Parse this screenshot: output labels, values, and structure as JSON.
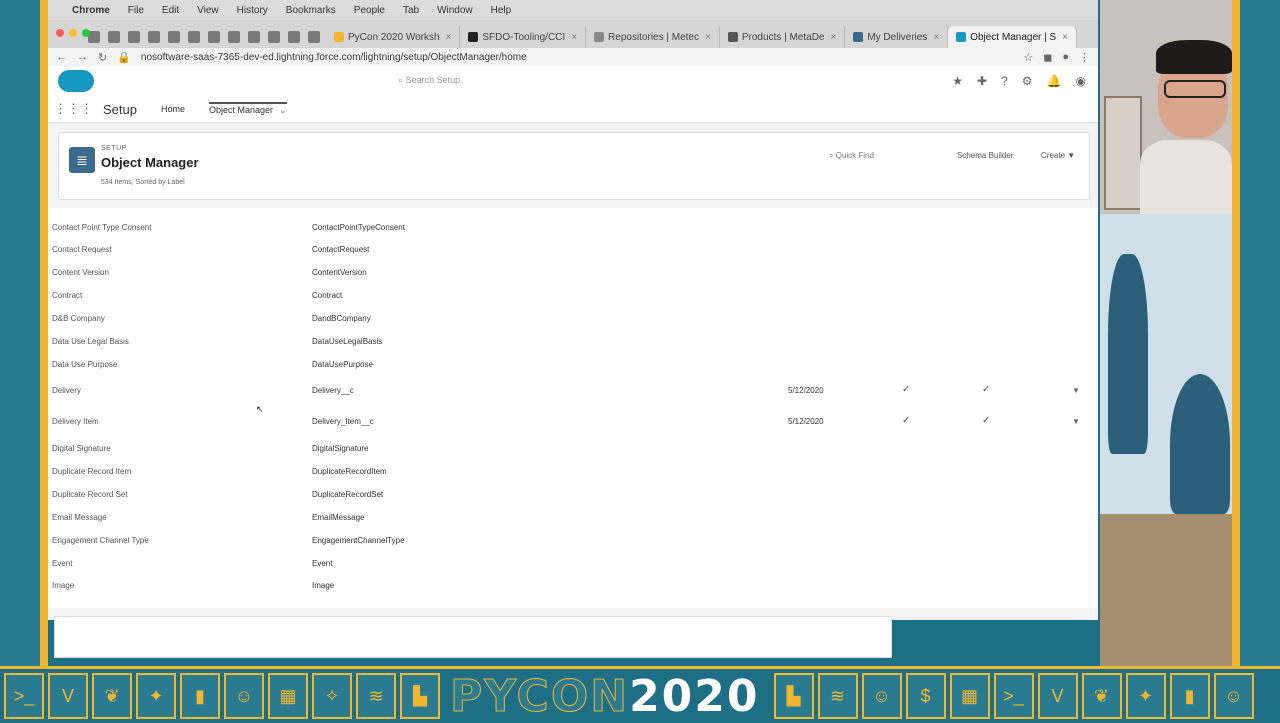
{
  "browser": {
    "menubar": [
      "Chrome",
      "File",
      "Edit",
      "View",
      "History",
      "Bookmarks",
      "People",
      "Tab",
      "Window",
      "Help"
    ],
    "tabs": [
      {
        "label": "PyCon 2020 Worksh",
        "color": "#f2b631",
        "active": false
      },
      {
        "label": "SFDO-Tooling/CCI",
        "color": "#222222",
        "active": false
      },
      {
        "label": "Repositories | Metec",
        "color": "#888888",
        "active": false
      },
      {
        "label": "Products | MetaDe",
        "color": "#555555",
        "active": false
      },
      {
        "label": "My Deliveries",
        "color": "#3b6b8c",
        "active": false
      },
      {
        "label": "Object Manager | S",
        "color": "#1798c1",
        "active": true
      }
    ],
    "url": "nosoftware-saas-7365-dev-ed.lightning.force.com/lightning/setup/ObjectManager/home"
  },
  "salesforce": {
    "search_placeholder": "Search Setup",
    "app_name": "Setup",
    "nav": {
      "home": "Home",
      "object_manager": "Object Manager"
    }
  },
  "header": {
    "breadcrumb": "SETUP",
    "title": "Object Manager",
    "item_count": "534 Items, Sorted by Label",
    "quick_find": "Quick Find",
    "schema_builder": "Schema Builder",
    "create": "Create"
  },
  "objects": [
    {
      "label": "Contact Point Type Consent",
      "api": "ContactPointTypeConsent",
      "date": "",
      "c1": "",
      "c2": "",
      "menu": ""
    },
    {
      "label": "Contact Request",
      "api": "ContactRequest",
      "date": "",
      "c1": "",
      "c2": "",
      "menu": ""
    },
    {
      "label": "Content Version",
      "api": "ContentVersion",
      "date": "",
      "c1": "",
      "c2": "",
      "menu": ""
    },
    {
      "label": "Contract",
      "api": "Contract",
      "date": "",
      "c1": "",
      "c2": "",
      "menu": ""
    },
    {
      "label": "D&B Company",
      "api": "DandBCompany",
      "date": "",
      "c1": "",
      "c2": "",
      "menu": ""
    },
    {
      "label": "Data Use Legal Basis",
      "api": "DataUseLegalBasis",
      "date": "",
      "c1": "",
      "c2": "",
      "menu": ""
    },
    {
      "label": "Data Use Purpose",
      "api": "DataUsePurpose",
      "date": "",
      "c1": "",
      "c2": "",
      "menu": ""
    },
    {
      "label": "Delivery",
      "api": "Delivery__c",
      "date": "5/12/2020",
      "c1": "✓",
      "c2": "✓",
      "menu": "▼"
    },
    {
      "label": "Delivery Item",
      "api": "Delivery_Item__c",
      "date": "5/12/2020",
      "c1": "✓",
      "c2": "✓",
      "menu": "▼"
    },
    {
      "label": "Digital Signature",
      "api": "DigitalSignature",
      "date": "",
      "c1": "",
      "c2": "",
      "menu": ""
    },
    {
      "label": "Duplicate Record Item",
      "api": "DuplicateRecordItem",
      "date": "",
      "c1": "",
      "c2": "",
      "menu": ""
    },
    {
      "label": "Duplicate Record Set",
      "api": "DuplicateRecordSet",
      "date": "",
      "c1": "",
      "c2": "",
      "menu": ""
    },
    {
      "label": "Email Message",
      "api": "EmailMessage",
      "date": "",
      "c1": "",
      "c2": "",
      "menu": ""
    },
    {
      "label": "Engagement Channel Type",
      "api": "EngagementChannelType",
      "date": "",
      "c1": "",
      "c2": "",
      "menu": ""
    },
    {
      "label": "Event",
      "api": "Event",
      "date": "",
      "c1": "",
      "c2": "",
      "menu": ""
    },
    {
      "label": "Image",
      "api": "Image",
      "date": "",
      "c1": "",
      "c2": "",
      "menu": ""
    }
  ],
  "banner": {
    "wordmark_py": "PYCON",
    "wordmark_year": "2020",
    "accent": "#f2b631",
    "base": "#1e6f85"
  }
}
